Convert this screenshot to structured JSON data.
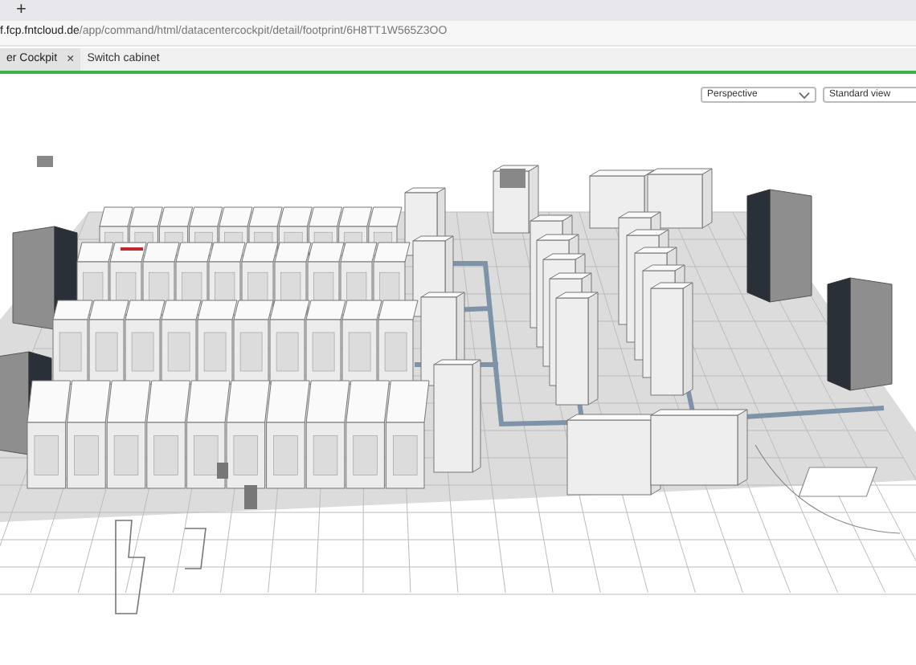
{
  "browser": {
    "new_tab": "+",
    "url_host": "f.fcp.fntcloud.de",
    "url_path": "/app/command/html/datacentercockpit/detail/footprint/6H8TT1W565Z3OO"
  },
  "tabs": [
    {
      "label": "er Cockpit",
      "close": "×",
      "selected": true
    },
    {
      "label": "Switch cabinet",
      "selected": false
    }
  ],
  "toolbar": {
    "projection": "Perspective",
    "view": "Standard view"
  }
}
